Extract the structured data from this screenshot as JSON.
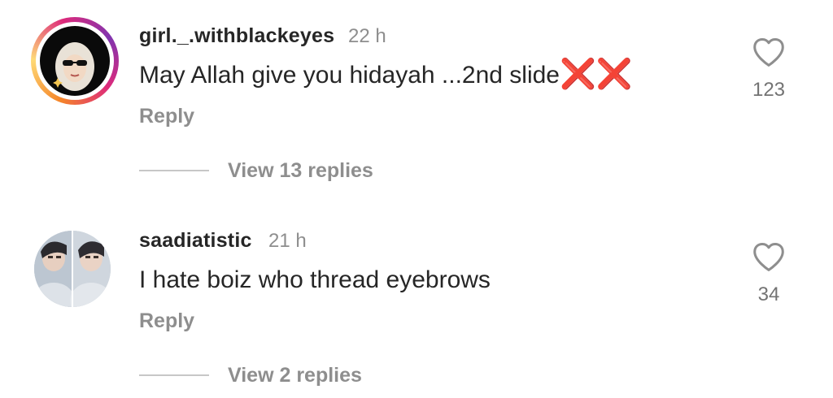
{
  "comments": [
    {
      "username": "girl._.withblackeyes",
      "time": "22 h",
      "text": "May Allah give you hidayah ...2nd slide",
      "emoji": "❌❌",
      "reply_label": "Reply",
      "like_count": "123",
      "view_replies": "View 13 replies",
      "avatar_style": "story-ring"
    },
    {
      "username": "saadiatistic",
      "time": "21 h",
      "text": "I hate boiz who thread eyebrows",
      "reply_label": "Reply",
      "like_count": "34",
      "view_replies": "View 2 replies",
      "avatar_style": "photo"
    }
  ],
  "icons": {
    "like": "heart-outline-icon",
    "emoji": "cross-mark-emoji"
  },
  "colors": {
    "text": "#262626",
    "secondary": "#8e8e8e",
    "emoji_red": "#e5262a",
    "ring_start": "#f58529",
    "ring_end": "#8134af"
  }
}
